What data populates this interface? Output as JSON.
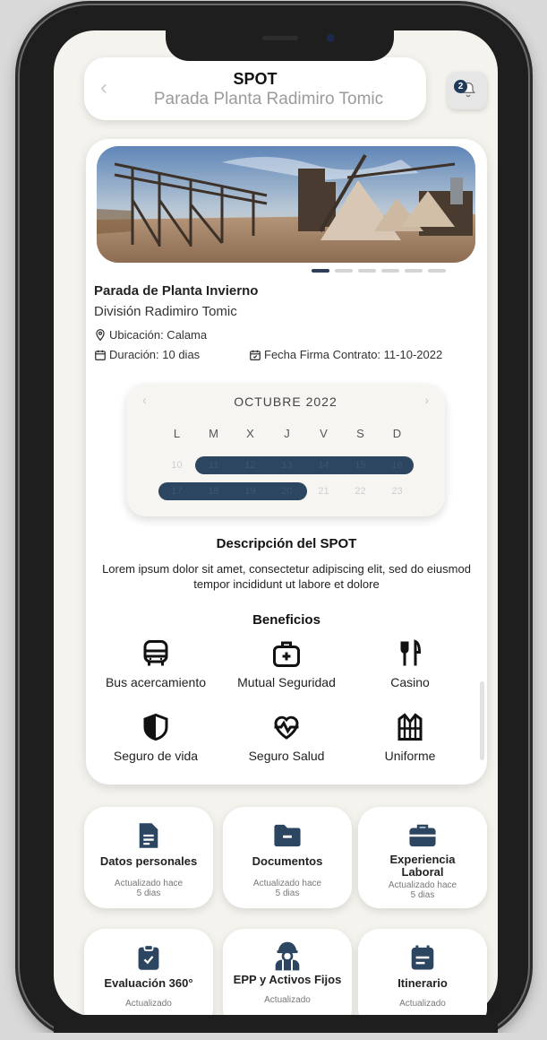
{
  "header": {
    "title": "SPOT",
    "subtitle": "Parada Planta Radimiro Tomic",
    "notification_count": "2"
  },
  "event": {
    "title": "Parada de Planta Invierno",
    "division": "División Radimiro Tomic",
    "location": "Ubicación: Calama",
    "duration": "Duración: 10 dias",
    "contract_date": "Fecha Firma Contrato: 11-10-2022",
    "carousel_pages": 6,
    "carousel_active": 1
  },
  "calendar": {
    "month": "OCTUBRE 2022",
    "weekdays": [
      "L",
      "M",
      "X",
      "J",
      "V",
      "S",
      "D"
    ],
    "week1": [
      "10",
      "11",
      "12",
      "13",
      "14",
      "15",
      "16"
    ],
    "week2": [
      "17",
      "18",
      "19",
      "20",
      "21",
      "22",
      "23"
    ],
    "selected_range": [
      "11",
      "20"
    ]
  },
  "description": {
    "title": "Descripción del SPOT",
    "text": "Lorem ipsum dolor sit amet, consectetur adipiscing elit, sed do eiusmod tempor incididunt ut labore et dolore"
  },
  "benefits": {
    "title": "Beneficios",
    "items": [
      {
        "label": "Bus acercamiento",
        "icon": "bus-icon"
      },
      {
        "label": "Mutual Seguridad",
        "icon": "first-aid-kit-icon"
      },
      {
        "label": "Casino",
        "icon": "fork-knife-icon"
      },
      {
        "label": "Seguro de vida",
        "icon": "shield-icon"
      },
      {
        "label": "Seguro Salud",
        "icon": "heart-pulse-icon"
      },
      {
        "label": "Uniforme",
        "icon": "vest-icon"
      }
    ]
  },
  "sections": [
    {
      "title": "Datos personales",
      "status": "Actualizado hace 5 dias",
      "icon": "document-icon"
    },
    {
      "title": "Documentos",
      "status": "Actualizado hace 5 dias",
      "icon": "folder-icon"
    },
    {
      "title": "Experiencia Laboral",
      "status": "Actualizado hace 5 dias",
      "icon": "briefcase-icon"
    },
    {
      "title": "Evaluación 360°",
      "status": "Actualizado",
      "icon": "clipboard-icon"
    },
    {
      "title": "EPP y Activos Fijos",
      "status": "Actualizado",
      "icon": "worker-helmet-icon"
    },
    {
      "title": "Itinerario",
      "status": "Actualizado",
      "icon": "calendar-icon"
    }
  ],
  "colors": {
    "primary": "#2c4560",
    "background": "#f5f3ee"
  }
}
